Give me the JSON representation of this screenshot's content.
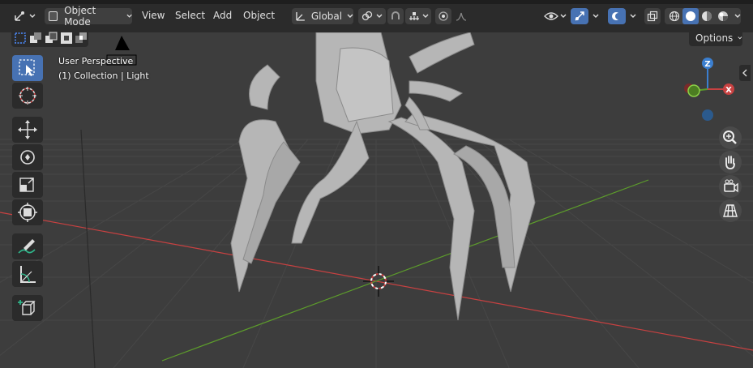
{
  "header": {
    "editor_type_icon": "view3d-icon",
    "mode": {
      "label": "Object Mode",
      "icon": "object-mode-icon"
    },
    "menus": [
      "View",
      "Select",
      "Add",
      "Object"
    ],
    "transform_orientation": {
      "label": "Global",
      "icon": "orientation-icon"
    },
    "pivot_icon": "pivot-icon",
    "snap_icon": "snap-icon",
    "snap_increment_icon": "snap-increment-icon",
    "proportional_icon": "proportional-edit-icon",
    "falloff_icon": "falloff-icon",
    "visibility_icon": "eye-icon",
    "gizmo_icon": "gizmo-icon",
    "overlay_icon": "overlay-icon",
    "xray_icon": "xray-icon",
    "shading_modes": [
      "wireframe",
      "solid",
      "material",
      "rendered"
    ],
    "active_shading": "solid"
  },
  "viewport": {
    "perspective_label": "User Perspective",
    "collection_label": "(1) Collection | Light",
    "options_label": "Options",
    "gizmo_axes": {
      "z": "Z",
      "x": "X"
    },
    "colors": {
      "x_axis": "#c84141",
      "y_axis": "#5d9d2b",
      "z_axis": "#3b7fd0",
      "active": "#4772b3"
    }
  },
  "toolbar": {
    "tools": [
      "select-box",
      "cursor",
      "move",
      "rotate",
      "scale",
      "transform",
      "annotate",
      "measure",
      "add-cube"
    ],
    "active_tool": "select-box"
  },
  "nav_buttons": [
    "zoom",
    "pan",
    "camera",
    "perspective-toggle"
  ]
}
